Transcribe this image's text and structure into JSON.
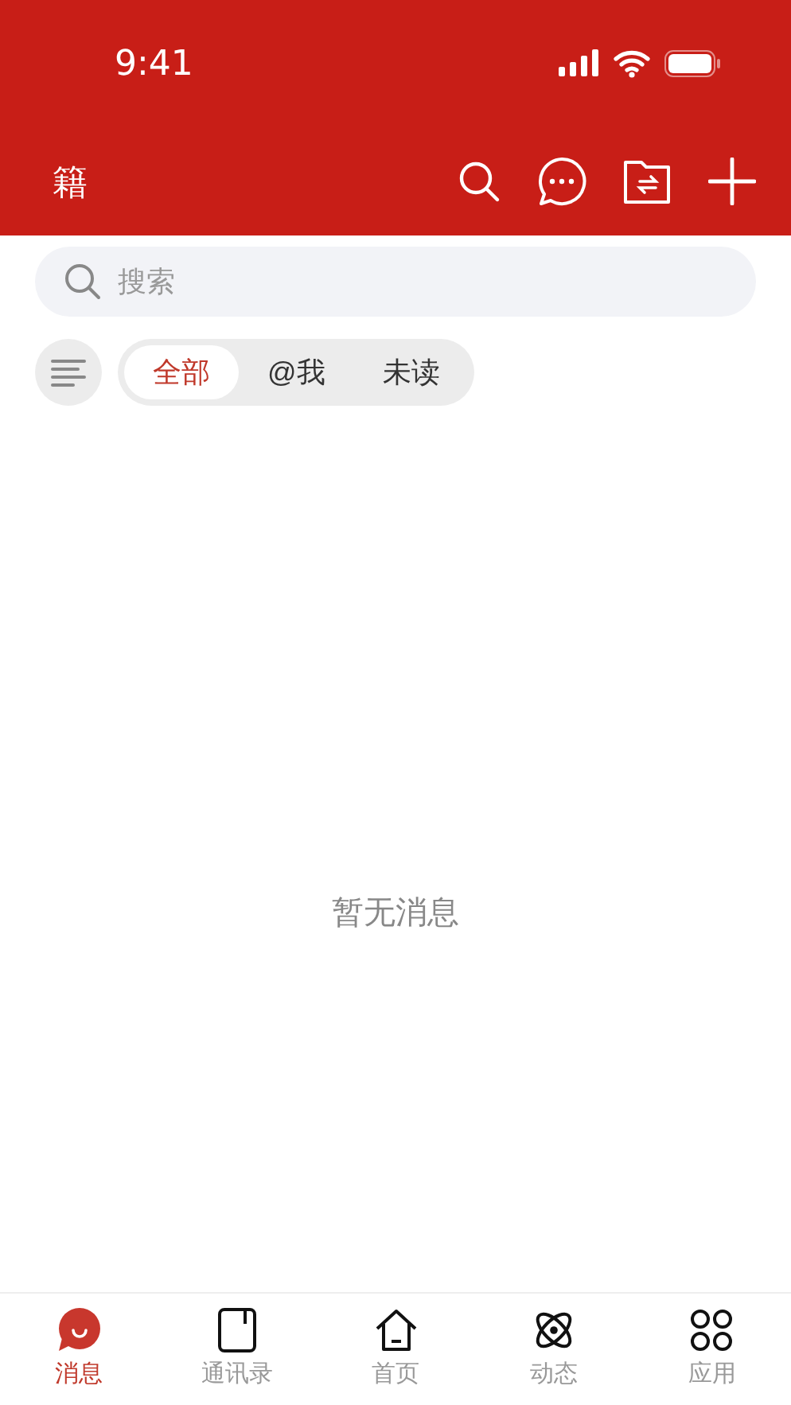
{
  "status_bar": {
    "time": "9:41"
  },
  "header": {
    "title": "籍"
  },
  "search": {
    "placeholder": "搜索"
  },
  "filters": [
    {
      "label": "全部",
      "selected": true
    },
    {
      "label": "@我",
      "selected": false
    },
    {
      "label": "未读",
      "selected": false
    }
  ],
  "empty_message": "暂无消息",
  "tab_bar": [
    {
      "label": "消息",
      "kind": "chat",
      "selected": true
    },
    {
      "label": "通讯录",
      "kind": "contacts",
      "selected": false
    },
    {
      "label": "首页",
      "kind": "home",
      "selected": false
    },
    {
      "label": "动态",
      "kind": "atom",
      "selected": false
    },
    {
      "label": "应用",
      "kind": "apps",
      "selected": false
    }
  ]
}
